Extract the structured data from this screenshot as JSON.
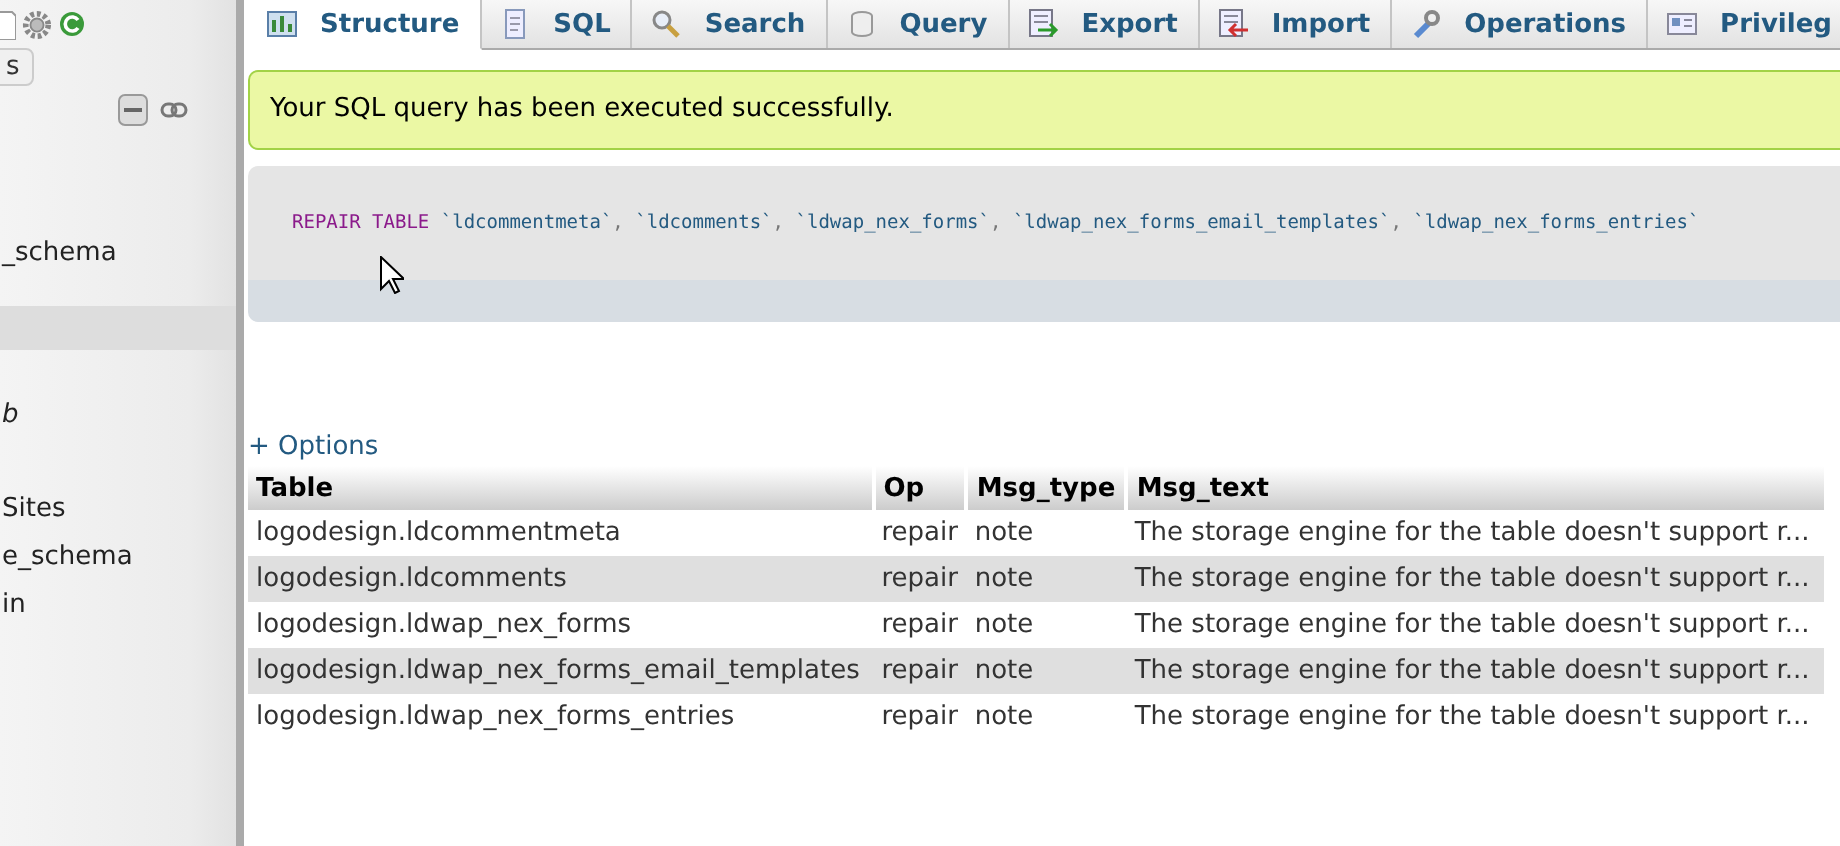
{
  "sidebar": {
    "button_label": "s",
    "items": [
      {
        "label": "_schema",
        "italic": false
      },
      {
        "label": "b",
        "italic": true
      },
      {
        "label": "Sites",
        "italic": false
      },
      {
        "label": "e_schema",
        "italic": false
      },
      {
        "label": "in",
        "italic": false
      }
    ]
  },
  "tabs": [
    {
      "label": "Structure",
      "selected": true
    },
    {
      "label": "SQL",
      "selected": false
    },
    {
      "label": "Search",
      "selected": false
    },
    {
      "label": "Query",
      "selected": false
    },
    {
      "label": "Export",
      "selected": false
    },
    {
      "label": "Import",
      "selected": false
    },
    {
      "label": "Operations",
      "selected": false
    },
    {
      "label": "Privileg",
      "selected": false
    }
  ],
  "message": "Your SQL query has been executed successfully.",
  "query": [
    {
      "kind": "keyword",
      "text": "REPAIR TABLE"
    },
    {
      "kind": "identifier",
      "text": "`ldcommentmeta`"
    },
    {
      "kind": "punct",
      "text": ","
    },
    {
      "kind": "identifier",
      "text": "`ldcomments`"
    },
    {
      "kind": "punct",
      "text": ","
    },
    {
      "kind": "identifier",
      "text": "`ldwap_nex_forms`"
    },
    {
      "kind": "punct",
      "text": ","
    },
    {
      "kind": "identifier",
      "text": "`ldwap_nex_forms_email_templates`"
    },
    {
      "kind": "punct",
      "text": ","
    },
    {
      "kind": "identifier",
      "text": "`ldwap_nex_forms_entries`"
    }
  ],
  "options_link": "+ Options",
  "table": {
    "columns": [
      "Table",
      "Op",
      "Msg_type",
      "Msg_text"
    ],
    "rows": [
      [
        "logodesign.ldcommentmeta",
        "repair",
        "note",
        "The storage engine for the table doesn't support r..."
      ],
      [
        "logodesign.ldcomments",
        "repair",
        "note",
        "The storage engine for the table doesn't support r..."
      ],
      [
        "logodesign.ldwap_nex_forms",
        "repair",
        "note",
        "The storage engine for the table doesn't support r..."
      ],
      [
        "logodesign.ldwap_nex_forms_email_templates",
        "repair",
        "note",
        "The storage engine for the table doesn't support r..."
      ],
      [
        "logodesign.ldwap_nex_forms_entries",
        "repair",
        "note",
        "The storage engine for the table doesn't support r..."
      ]
    ]
  }
}
